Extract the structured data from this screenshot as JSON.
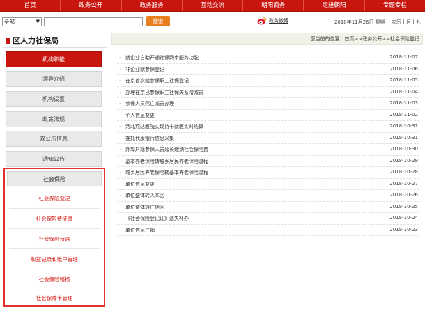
{
  "nav": [
    "首页",
    "政务公开",
    "政务服务",
    "互动交流",
    "朝阳商务",
    "走进朝阳",
    "专题专栏"
  ],
  "toolbar": {
    "select_value": "全部",
    "search_button": "搜索",
    "weibo_label": "政务微博",
    "date": "2018年11月26日 星期一 农历十月十九"
  },
  "sidebar": {
    "title": "区人力社保局",
    "items": [
      "机构职能",
      "领导介绍",
      "机构设置",
      "政策法规",
      "双公示信息",
      "通知公告"
    ],
    "sub_head": "社会保险",
    "sub_items": [
      "社会保险登记",
      "社会保险费征缴",
      "社会保险待遇",
      "权益记录和账户管理",
      "社会保险稽核",
      "社会保障卡管理"
    ]
  },
  "content": {
    "breadcrumb": "您当前的位置：首页>>政务公开>>社会保险登记",
    "news": [
      {
        "title": "就企业自助开通社保网申服务功能",
        "date": "2018-11-07"
      },
      {
        "title": "非企业就参保登记",
        "date": "2018-11-06"
      },
      {
        "title": "在京首次就参保职工社保登记",
        "date": "2018-11-05"
      },
      {
        "title": "办理在京已参保职工社保关系增减员",
        "date": "2018-11-04"
      },
      {
        "title": "参保人员死亡减员办理",
        "date": "2018-11-03"
      },
      {
        "title": "个人信息变更",
        "date": "2018-11-02"
      },
      {
        "title": "河北燕达医院实现持卡就医实时结算",
        "date": "2018-10-31"
      },
      {
        "title": "委托代发银行信息采集",
        "date": "2018-10-31"
      },
      {
        "title": "外埠户籍参保人员延长缴纳社会保险费",
        "date": "2018-10-30"
      },
      {
        "title": "基本养老保险转城乡居民养老保险流程",
        "date": "2018-10-29"
      },
      {
        "title": "城乡居民养老保险转基本养老保险流程",
        "date": "2018-10-28"
      },
      {
        "title": "单位信息变更",
        "date": "2018-10-27"
      },
      {
        "title": "单位整体转入本区",
        "date": "2018-10-26"
      },
      {
        "title": "单位整体转往他区",
        "date": "2018-10-25"
      },
      {
        "title": "《社会保险登记证》遗失补办",
        "date": "2018-10-24"
      },
      {
        "title": "单位信息注销",
        "date": "2018-10-23"
      }
    ]
  }
}
